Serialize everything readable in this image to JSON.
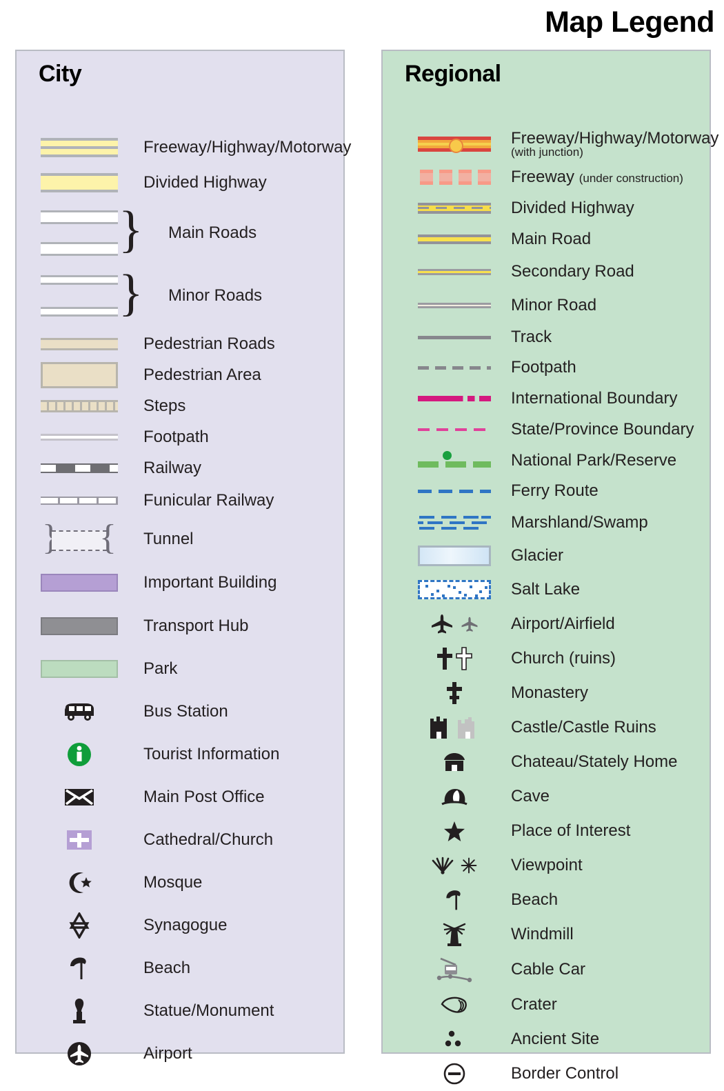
{
  "title": "Map Legend",
  "city": {
    "heading": "City",
    "items": [
      {
        "label": "Freeway/Highway/Motorway",
        "symbol": "city-freeway-swatch"
      },
      {
        "label": "Divided Highway",
        "symbol": "city-divided-highway-swatch"
      },
      {
        "label": "Main Roads",
        "symbol": "city-main-roads-swatch-pair"
      },
      {
        "label": "Minor Roads",
        "symbol": "city-minor-roads-swatch-pair"
      },
      {
        "label": "Pedestrian Roads",
        "symbol": "city-pedestrian-road-swatch"
      },
      {
        "label": "Pedestrian Area",
        "symbol": "city-pedestrian-area-swatch"
      },
      {
        "label": "Steps",
        "symbol": "city-steps-swatch"
      },
      {
        "label": "Footpath",
        "symbol": "city-footpath-swatch"
      },
      {
        "label": "Railway",
        "symbol": "city-railway-swatch"
      },
      {
        "label": "Funicular Railway",
        "symbol": "city-funicular-railway-swatch"
      },
      {
        "label": "Tunnel",
        "symbol": "city-tunnel-swatch"
      },
      {
        "label": "Important Building",
        "symbol": "city-important-building-swatch"
      },
      {
        "label": "Transport Hub",
        "symbol": "city-transport-hub-swatch"
      },
      {
        "label": "Park",
        "symbol": "city-park-swatch"
      },
      {
        "label": "Bus Station",
        "symbol": "bus-icon"
      },
      {
        "label": "Tourist Information",
        "symbol": "information-icon"
      },
      {
        "label": "Main Post Office",
        "symbol": "envelope-icon"
      },
      {
        "label": "Cathedral/Church",
        "symbol": "cross-on-purple-icon"
      },
      {
        "label": "Mosque",
        "symbol": "star-and-crescent-icon"
      },
      {
        "label": "Synagogue",
        "symbol": "star-of-david-icon"
      },
      {
        "label": "Beach",
        "symbol": "parasol-icon"
      },
      {
        "label": "Statue/Monument",
        "symbol": "statue-icon"
      },
      {
        "label": "Airport",
        "symbol": "airplane-in-circle-icon"
      }
    ]
  },
  "regional": {
    "heading": "Regional",
    "items": [
      {
        "label": "Freeway/Highway/Motorway",
        "sublabel": "(with junction)",
        "symbol": "regional-freeway-junction-swatch"
      },
      {
        "label": "Freeway",
        "inline_sublabel": "(under construction)",
        "symbol": "regional-freeway-construction-swatch"
      },
      {
        "label": "Divided Highway",
        "symbol": "regional-divided-highway-swatch"
      },
      {
        "label": "Main Road",
        "symbol": "regional-main-road-swatch"
      },
      {
        "label": "Secondary Road",
        "symbol": "regional-secondary-road-swatch"
      },
      {
        "label": "Minor Road",
        "symbol": "regional-minor-road-swatch"
      },
      {
        "label": "Track",
        "symbol": "regional-track-swatch"
      },
      {
        "label": "Footpath",
        "symbol": "regional-footpath-swatch"
      },
      {
        "label": "International Boundary",
        "symbol": "regional-international-boundary-swatch"
      },
      {
        "label": "State/Province Boundary",
        "symbol": "regional-state-boundary-swatch"
      },
      {
        "label": "National Park/Reserve",
        "symbol": "regional-national-park-swatch"
      },
      {
        "label": "Ferry Route",
        "symbol": "regional-ferry-route-swatch"
      },
      {
        "label": "Marshland/Swamp",
        "symbol": "regional-marshland-swatch"
      },
      {
        "label": "Glacier",
        "symbol": "regional-glacier-swatch"
      },
      {
        "label": "Salt Lake",
        "symbol": "regional-salt-lake-swatch"
      },
      {
        "label": "Airport/Airfield",
        "symbol": "airplane-icon-pair"
      },
      {
        "label": "Church (ruins)",
        "symbol": "cross-icon-pair"
      },
      {
        "label": "Monastery",
        "symbol": "orthodox-cross-icon"
      },
      {
        "label": "Castle/Castle Ruins",
        "symbol": "castle-icon-pair"
      },
      {
        "label": "Chateau/Stately Home",
        "symbol": "chateau-icon"
      },
      {
        "label": "Cave",
        "symbol": "cave-icon"
      },
      {
        "label": "Place of Interest",
        "symbol": "star-icon"
      },
      {
        "label": "Viewpoint",
        "symbol": "viewpoint-icon-pair"
      },
      {
        "label": "Beach",
        "symbol": "parasol-icon"
      },
      {
        "label": "Windmill",
        "symbol": "windmill-icon"
      },
      {
        "label": "Cable Car",
        "symbol": "cable-car-icon"
      },
      {
        "label": "Crater",
        "symbol": "crater-icon"
      },
      {
        "label": "Ancient Site",
        "symbol": "ancient-site-icon"
      },
      {
        "label": "Border Control",
        "symbol": "border-control-icon"
      }
    ]
  },
  "colors": {
    "city_panel_bg": "#e2e0ee",
    "regional_panel_bg": "#c5e2cc",
    "panel_border": "#b9bcc4",
    "highway_yellow": "#fdf3aa",
    "pedestrian_tan": "#eadfc6",
    "important_building_purple": "#b59fd4",
    "transport_hub_gray": "#8f8f93",
    "park_green": "#bcdcbf",
    "freeway_red": "#d9453f",
    "freeway_orange": "#f2a83c",
    "road_yellow": "#f8e14e",
    "boundary_magenta": "#d4197f",
    "ferry_blue": "#2f75c4",
    "park_line_green": "#6fbb5e",
    "tourist_info_green": "#0f9d3a",
    "text": "#231f20"
  }
}
